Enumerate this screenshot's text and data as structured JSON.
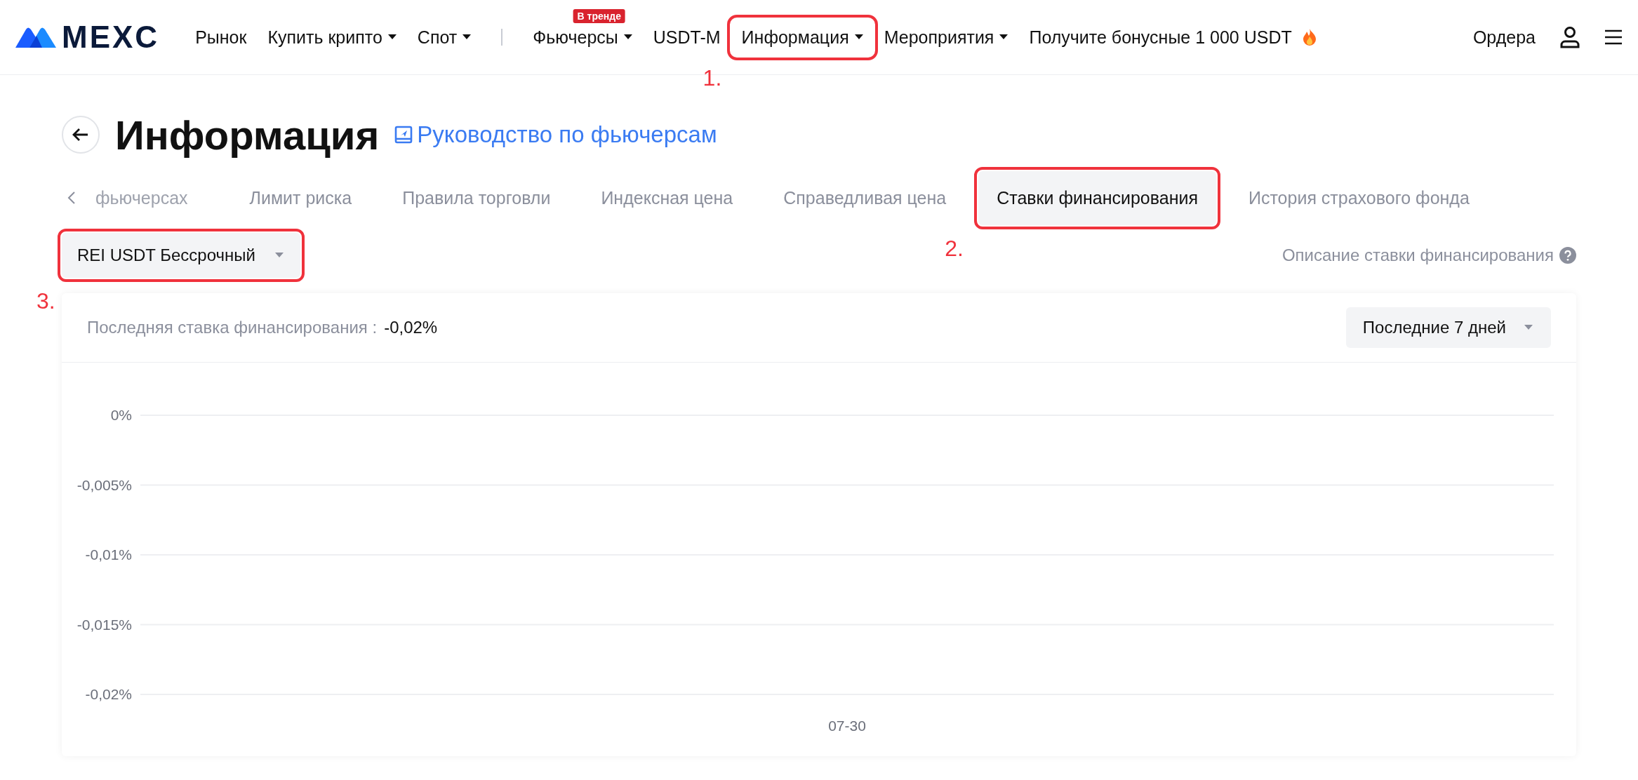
{
  "header": {
    "logo": "MEXC",
    "nav": [
      {
        "kind": "link",
        "label": "Рынок",
        "dropdown": false,
        "highlighted": false
      },
      {
        "kind": "link",
        "label": "Купить крипто",
        "dropdown": true,
        "highlighted": false
      },
      {
        "kind": "link",
        "label": "Спот",
        "dropdown": true,
        "highlighted": false
      },
      {
        "kind": "separator"
      },
      {
        "kind": "link",
        "label": "Фьючерсы",
        "dropdown": true,
        "badge": "В тренде",
        "highlighted": false
      },
      {
        "kind": "link",
        "label": "USDT-M",
        "dropdown": false,
        "highlighted": false
      },
      {
        "kind": "link",
        "label": "Информация",
        "dropdown": true,
        "highlighted": true,
        "annotation": "1."
      },
      {
        "kind": "link",
        "label": "Мероприятия",
        "dropdown": true,
        "highlighted": false
      },
      {
        "kind": "promo",
        "label": "Получите бонусные 1 000 USDT",
        "dropdown": false,
        "highlighted": false
      }
    ],
    "orders": "Ордера"
  },
  "page": {
    "title": "Информация",
    "guide_link": "Руководство по фьючерсам"
  },
  "tabs": [
    {
      "label": "фьючерсах",
      "selected": false,
      "highlighted": false
    },
    {
      "label": "Лимит риска",
      "selected": false,
      "highlighted": false
    },
    {
      "label": "Правила торговли",
      "selected": false,
      "highlighted": false
    },
    {
      "label": "Индексная цена",
      "selected": false,
      "highlighted": false
    },
    {
      "label": "Справедливая цена",
      "selected": false,
      "highlighted": false
    },
    {
      "label": "Ставки финансирования",
      "selected": true,
      "highlighted": true,
      "annotation": "2."
    },
    {
      "label": "История страхового фонда",
      "selected": false,
      "highlighted": false
    }
  ],
  "contract_select": {
    "value": "REI USDT Бессрочный",
    "highlighted": true,
    "annotation": "3."
  },
  "help_link": "Описание ставки финансирования",
  "card": {
    "latest_label": "Последняя ставка финансирования :",
    "latest_value": "-0,02%",
    "period": "Последние 7 дней",
    "chart_data": {
      "type": "line",
      "grid": true,
      "categories": [
        "07-30"
      ],
      "ylim": [
        -0.02,
        0
      ],
      "yticks": [
        {
          "value": 0,
          "label": "0%"
        },
        {
          "value": -0.005,
          "label": "-0,005%"
        },
        {
          "value": -0.01,
          "label": "-0,01%"
        },
        {
          "value": -0.015,
          "label": "-0,015%"
        },
        {
          "value": -0.02,
          "label": "-0,02%"
        }
      ]
    }
  }
}
